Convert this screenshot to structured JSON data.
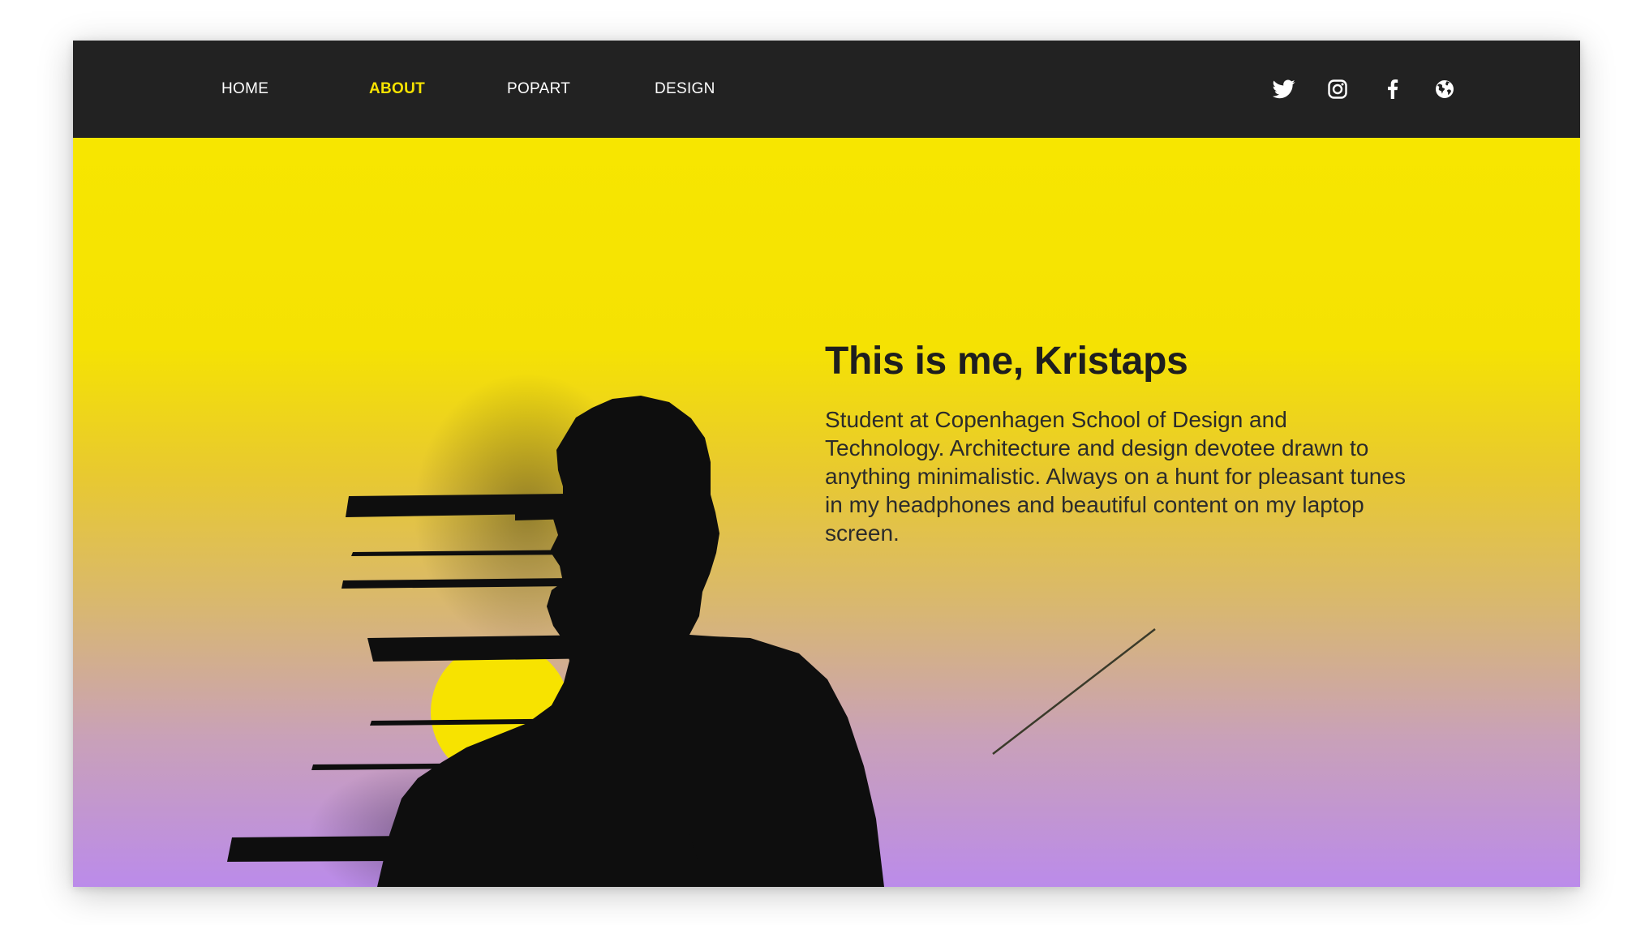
{
  "nav": {
    "items": [
      {
        "label": "HOME",
        "active": false
      },
      {
        "label": "ABOUT",
        "active": true
      },
      {
        "label": "POPART",
        "active": false
      },
      {
        "label": "DESIGN",
        "active": false
      }
    ],
    "active_color": "#F7E300",
    "text_color": "#FFFFFF",
    "background": "#222222"
  },
  "social": {
    "icons": [
      "twitter-icon",
      "instagram-icon",
      "facebook-icon",
      "globe-icon"
    ],
    "color": "#FFFFFF"
  },
  "hero": {
    "title": "This is me, Kristaps",
    "bio": "Student at Copenhagen School of Design and Technology. Architecture and design devotee drawn to anything minimalistic. Always on a hunt for pleasant tunes in my headphones and beautiful content on my laptop screen.",
    "gradient": [
      "#F7E600",
      "#F2DB08",
      "#D9B96C",
      "#CBA4B2",
      "#BB8BEA"
    ],
    "sun_color": "#F7E300",
    "silhouette_color": "#0E0E0E"
  }
}
